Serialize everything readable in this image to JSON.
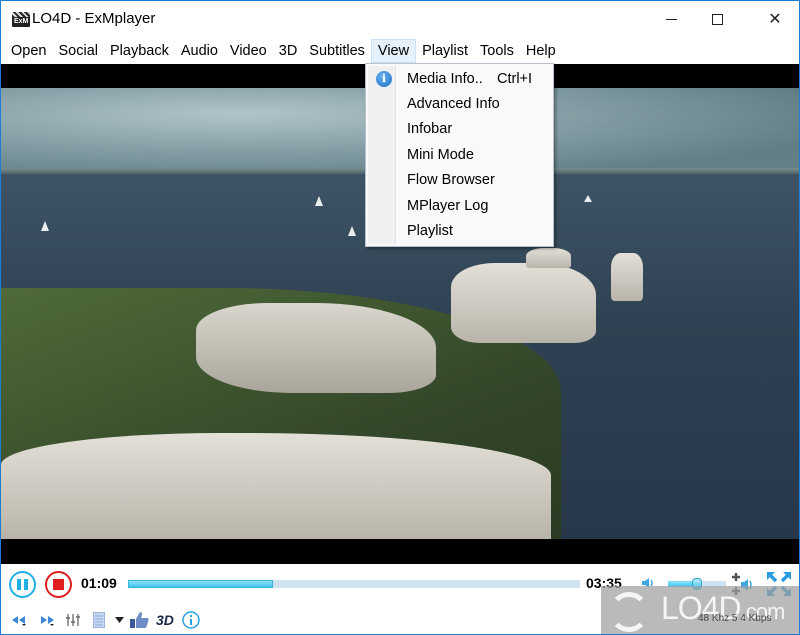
{
  "window": {
    "title": "LO4D - ExMplayer",
    "app_icon_text": "ExM",
    "controls": {
      "minimize": "minimize",
      "maximize": "maximize",
      "close": "close"
    }
  },
  "menubar": {
    "items": [
      {
        "label": "Open"
      },
      {
        "label": "Social"
      },
      {
        "label": "Playback"
      },
      {
        "label": "Audio"
      },
      {
        "label": "Video"
      },
      {
        "label": "3D"
      },
      {
        "label": "Subtitles"
      },
      {
        "label": "View",
        "active": true
      },
      {
        "label": "Playlist"
      },
      {
        "label": "Tools"
      },
      {
        "label": "Help"
      }
    ]
  },
  "view_menu": {
    "items": [
      {
        "label": "Media Info..",
        "shortcut": "Ctrl+I",
        "icon": "info-icon"
      },
      {
        "label": "Advanced Info"
      },
      {
        "label": "Infobar"
      },
      {
        "label": "Mini Mode"
      },
      {
        "label": "Flow Browser"
      },
      {
        "label": "MPlayer Log"
      },
      {
        "label": "Playlist"
      }
    ]
  },
  "playback": {
    "current_time": "01:09",
    "total_time": "03:35",
    "progress_fraction": 0.32,
    "volume_fraction": 0.5,
    "label_3d": "3D",
    "status": "48 Khz 5 4 Kbps",
    "accent_color": "#1fb0e6",
    "stop_color": "#e01e1e"
  },
  "watermark": {
    "text": "LO4D",
    "suffix": ".com"
  }
}
